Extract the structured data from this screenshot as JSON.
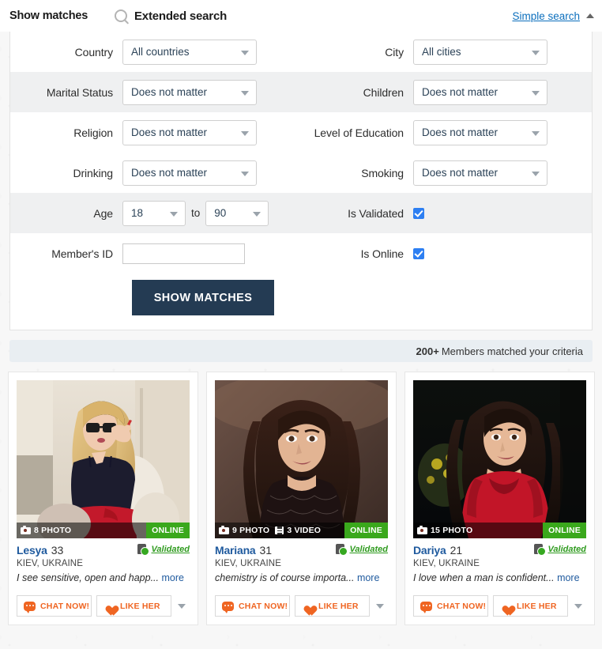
{
  "header": {
    "tab_label": "Show matches",
    "search_icon": "search-icon",
    "extended_title": "Extended search",
    "simple_search_label": "Simple search",
    "collapse_icon": "caret-up-icon"
  },
  "form": {
    "rows": [
      {
        "left": {
          "label": "Country",
          "control": "select",
          "value": "All countries"
        },
        "right": {
          "label": "City",
          "control": "select",
          "value": "All cities"
        }
      },
      {
        "left": {
          "label": "Marital Status",
          "control": "select",
          "value": "Does not matter"
        },
        "right": {
          "label": "Children",
          "control": "select",
          "value": "Does not matter"
        }
      },
      {
        "left": {
          "label": "Religion",
          "control": "select",
          "value": "Does not matter"
        },
        "right": {
          "label": "Level of Education",
          "control": "select",
          "value": "Does not matter"
        }
      },
      {
        "left": {
          "label": "Drinking",
          "control": "select",
          "value": "Does not matter"
        },
        "right": {
          "label": "Smoking",
          "control": "select",
          "value": "Does not matter"
        }
      }
    ],
    "age": {
      "label": "Age",
      "from_value": "18",
      "to_word": "to",
      "to_value": "90"
    },
    "is_validated": {
      "label": "Is Validated",
      "checked": true
    },
    "member_id": {
      "label": "Member's ID",
      "value": "",
      "placeholder": ""
    },
    "is_online": {
      "label": "Is Online",
      "checked": true
    },
    "submit_label": "SHOW MATCHES"
  },
  "results": {
    "count": "200+",
    "count_text": "Members matched your criteria",
    "cards": [
      {
        "name": "Lesya",
        "age": "33",
        "location": "KIEV, UKRAINE",
        "blurb": "I see sensitive, open and happ...",
        "more_label": "more",
        "photo_count": "8 PHOTO",
        "video_count": "",
        "online_label": "ONLINE",
        "validated_label": "Validated",
        "chat_label": "CHAT NOW!",
        "like_label": "LIKE HER"
      },
      {
        "name": "Mariana",
        "age": "31",
        "location": "KIEV, UKRAINE",
        "blurb": "chemistry is of course importa...",
        "more_label": "more",
        "photo_count": "9 PHOTO",
        "video_count": "3 VIDEO",
        "online_label": "ONLINE",
        "validated_label": "Validated",
        "chat_label": "CHAT NOW!",
        "like_label": "LIKE HER"
      },
      {
        "name": "Dariya",
        "age": "21",
        "location": "KIEV, UKRAINE",
        "blurb": "I love when a man is confident...",
        "more_label": "more",
        "photo_count": "15 PHOTO",
        "video_count": "",
        "online_label": "ONLINE",
        "validated_label": "Validated",
        "chat_label": "CHAT NOW!",
        "like_label": "LIKE HER"
      }
    ]
  },
  "colors": {
    "link": "#0c6fbd",
    "accent_orange": "#ef6522",
    "online_green": "#3aa81c",
    "validated_green": "#2f9b1f",
    "checkbox_blue": "#2d7ff2",
    "button_navy": "#243b53"
  }
}
